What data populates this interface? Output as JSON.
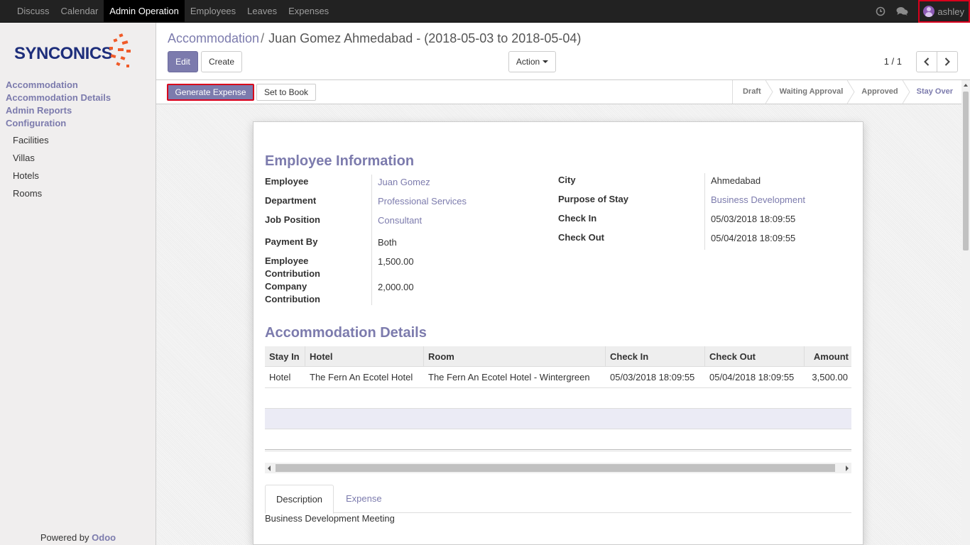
{
  "topbar": {
    "menu": [
      "Discuss",
      "Calendar",
      "Admin Operation",
      "Employees",
      "Leaves",
      "Expenses"
    ],
    "active": "Admin Operation",
    "user": "ashley",
    "icons": [
      "clock-icon",
      "chat-icon"
    ]
  },
  "sidebar": {
    "logo": "SYNCONICS",
    "sections": [
      "Accommodation",
      "Accommodation Details",
      "Admin Reports",
      "Configuration"
    ],
    "config_items": [
      "Facilities",
      "Villas",
      "Hotels",
      "Rooms"
    ],
    "powered_by": "Powered by",
    "powered_brand": "Odoo"
  },
  "breadcrumb": {
    "parent": "Accommodation",
    "separator": "/",
    "current": "Juan Gomez Ahmedabad - (2018-05-03 to 2018-05-04)"
  },
  "buttons": {
    "edit": "Edit",
    "create": "Create",
    "action": "Action",
    "generate_expense": "Generate Expense",
    "set_to_book": "Set to Book"
  },
  "pager": "1 / 1",
  "stages": [
    "Draft",
    "Waiting Approval",
    "Approved",
    "Stay Over"
  ],
  "current_stage": "Stay Over",
  "employee_info": {
    "heading": "Employee Information",
    "left": [
      {
        "label": "Employee",
        "value": "Juan Gomez"
      },
      {
        "label": "Department",
        "value": "Professional Services"
      },
      {
        "label": "Job Position",
        "value": "Consultant"
      },
      {
        "label": "Payment By",
        "value": "Both"
      },
      {
        "label": "Employee Contribution",
        "value": "1,500.00"
      },
      {
        "label": "Company Contribution",
        "value": "2,000.00"
      }
    ],
    "right": [
      {
        "label": "City",
        "value": "Ahmedabad"
      },
      {
        "label": "Purpose of Stay",
        "value": "Business Development"
      },
      {
        "label": "Check In",
        "value": "05/03/2018 18:09:55"
      },
      {
        "label": "Check Out",
        "value": "05/04/2018 18:09:55"
      }
    ]
  },
  "accommodation_details": {
    "heading": "Accommodation Details",
    "columns": [
      "Stay In",
      "Hotel",
      "Room",
      "Check In",
      "Check Out",
      "Amount"
    ],
    "rows": [
      [
        "Hotel",
        "The Fern An Ecotel Hotel",
        "The Fern An Ecotel Hotel - Wintergreen",
        "05/03/2018 18:09:55",
        "05/04/2018 18:09:55",
        "3,500.00"
      ]
    ]
  },
  "tabs": {
    "items": [
      "Description",
      "Expense"
    ],
    "active": "Description",
    "description_text": "Business Development Meeting"
  },
  "colors": {
    "brand": "#7c7bad",
    "topbar": "#222222",
    "highlight": "#d8001c",
    "logo_orange": "#f05a28",
    "logo_navy": "#1e2e7b"
  }
}
